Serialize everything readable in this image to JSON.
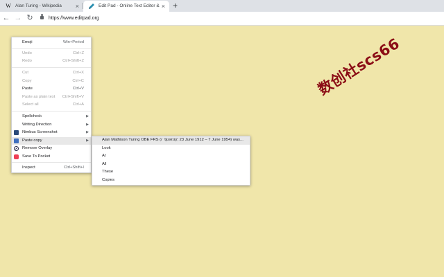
{
  "tabs": [
    {
      "title": "Alan Turing - Wikipedia",
      "favicon": "W",
      "active": false
    },
    {
      "title": "Edit Pad - Online Text Editor & No",
      "favicon": "",
      "active": true
    }
  ],
  "new_tab_symbol": "+",
  "close_symbol": "×",
  "toolbar": {
    "back_icon": "←",
    "forward_icon": "→",
    "reload_icon": "↻",
    "url": "https://www.editpad.org"
  },
  "context_menu": {
    "items": [
      {
        "label": "Emoji",
        "shortcut": "Win+Period",
        "disabled": false
      },
      {
        "label": "Undo",
        "shortcut": "Ctrl+Z",
        "disabled": true
      },
      {
        "label": "Redo",
        "shortcut": "Ctrl+Shift+Z",
        "disabled": true
      },
      {
        "label": "Cut",
        "shortcut": "Ctrl+X",
        "disabled": true
      },
      {
        "label": "Copy",
        "shortcut": "Ctrl+C",
        "disabled": true
      },
      {
        "label": "Paste",
        "shortcut": "Ctrl+V",
        "disabled": false
      },
      {
        "label": "Paste as plain text",
        "shortcut": "Ctrl+Shift+V",
        "disabled": true
      },
      {
        "label": "Select all",
        "shortcut": "Ctrl+A",
        "disabled": true
      },
      {
        "label": "Spellcheck",
        "arrow": "▶"
      },
      {
        "label": "Writing Direction",
        "arrow": "▶"
      },
      {
        "label": "Nimbus Screenshot",
        "arrow": "▶",
        "icon": "nimbus-screenshot-icon"
      },
      {
        "label": "Paste copy",
        "arrow": "▶",
        "icon": "paste-copy-icon"
      },
      {
        "label": "Remove Overlay",
        "icon": "remove-overlay-icon"
      },
      {
        "label": "Save To Pocket",
        "icon": "pocket-icon"
      },
      {
        "label": "Inspect",
        "shortcut": "Ctrl+Shift+I"
      }
    ]
  },
  "submenu": {
    "items": [
      "Alan Mathison Turing OBE FRS (/ ˈtjʊərɪŋ/; 23 June 1912 – 7 June 1954) was...",
      "Look",
      "At",
      "All",
      "These",
      "Copies"
    ]
  },
  "watermark": "数创社scs66",
  "colors": {
    "page_background": "#f0e6aa",
    "watermark": "#8b0d16",
    "pocket": "#ef4056"
  }
}
